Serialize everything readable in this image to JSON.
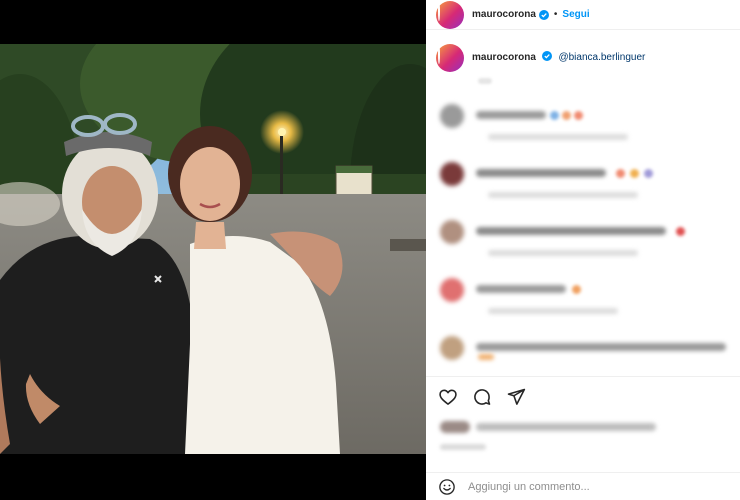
{
  "header": {
    "username": "maurocorona",
    "separator": "•",
    "follow_label": "Segui"
  },
  "caption": {
    "username": "maurocorona",
    "mention": "@bianca.berlinguer"
  },
  "comment_input": {
    "placeholder": "Aggiungi un commento..."
  },
  "icons": {
    "verified": "verified-badge-icon",
    "like": "heart-icon",
    "comment": "comment-bubble-icon",
    "share": "paper-plane-icon",
    "emoji": "emoji-smiley-icon"
  },
  "colors": {
    "link_blue": "#0095f6",
    "mention_blue": "#00376b",
    "text": "#262626",
    "muted": "#8e8e8e"
  }
}
